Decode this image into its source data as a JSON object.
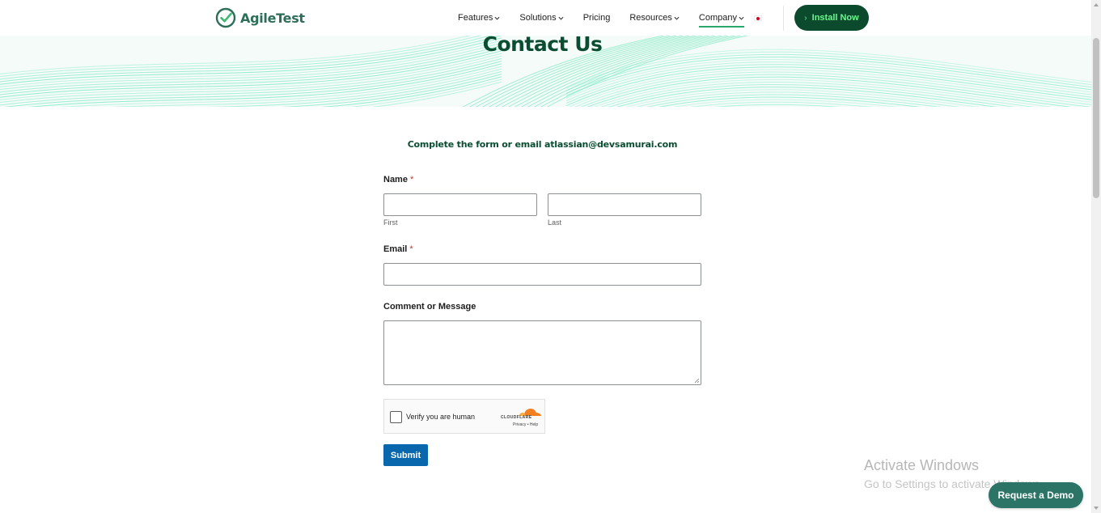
{
  "header": {
    "logo_text": "AgileTest",
    "logo_icon": "check-circle-icon",
    "nav": [
      {
        "label": "Features",
        "has_dropdown": true
      },
      {
        "label": "Solutions",
        "has_dropdown": true
      },
      {
        "label": "Pricing",
        "has_dropdown": false
      },
      {
        "label": "Resources",
        "has_dropdown": true
      },
      {
        "label": "Company",
        "has_dropdown": true,
        "active": true
      }
    ],
    "language_icon": "japan-flag-icon",
    "install_label": "Install Now",
    "colors": {
      "brand": "#2c6e59",
      "install_bg": "#0b4a2c",
      "install_text": "#6cf58e"
    }
  },
  "hero": {
    "title": "Contact Us"
  },
  "form": {
    "subtitle": "Complete the form or email atlassian@devsamurai.com",
    "name_label": "Name",
    "email_label": "Email",
    "required_mark": "*",
    "first_sublabel": "First",
    "last_sublabel": "Last",
    "first_value": "",
    "last_value": "",
    "email_value": "",
    "message_label": "Comment or Message",
    "message_value": "",
    "captcha_label": "Verify you are human",
    "captcha_brand": "CLOUDFLARE",
    "captcha_links": "Privacy • Help",
    "submit_label": "Submit",
    "colors": {
      "submit_bg": "#0867ad",
      "heading": "#0a4d32"
    }
  },
  "watermark": {
    "line1": "Activate Windows",
    "line2": "Go to Settings to activate Windows."
  },
  "demo": {
    "label": "Request a Demo"
  }
}
